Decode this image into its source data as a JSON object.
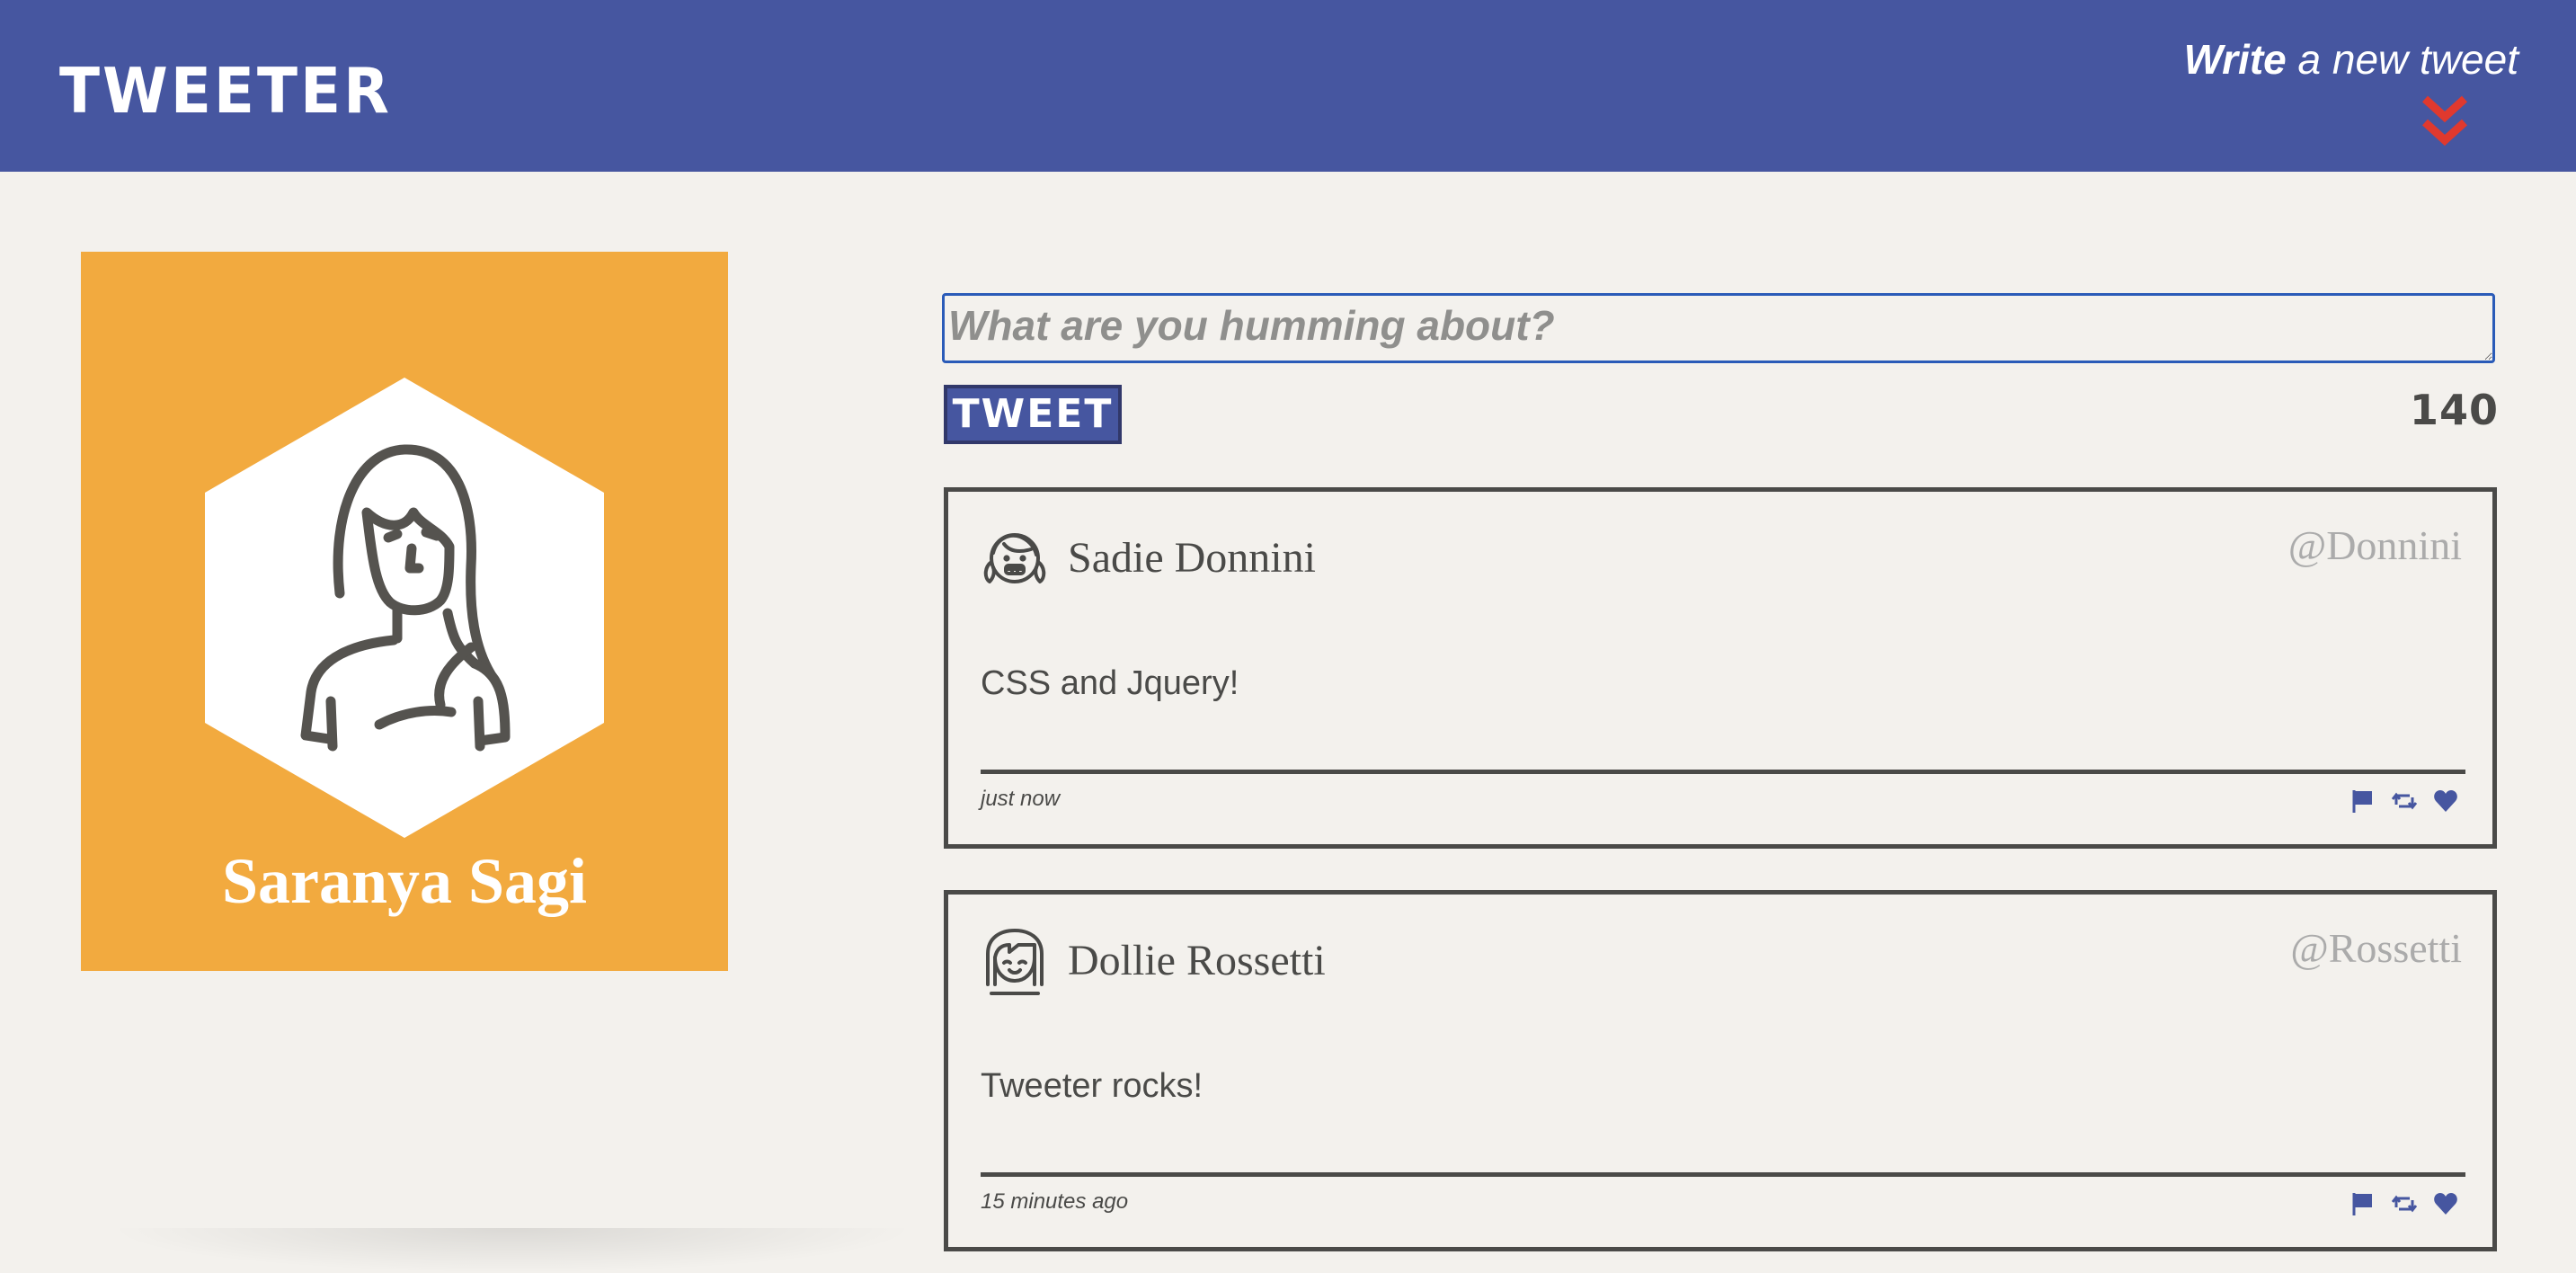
{
  "nav": {
    "brand": "TWEETER",
    "compose_bold": "Write",
    "compose_rest": " a new tweet",
    "chevron_icon": "double-chevron-down-icon",
    "chevron_color": "#e0392e"
  },
  "profile": {
    "name": "Saranya Sagi",
    "avatar_icon": "girl-avatar-icon",
    "background_color": "#f2aa3f"
  },
  "composer": {
    "placeholder": "What are you humming about?",
    "button_label": "TWEET",
    "counter": "140"
  },
  "tweets": [
    {
      "name": "Sadie Donnini",
      "handle": "@Donnini",
      "body": "CSS and Jquery!",
      "time": "just now",
      "avatar_icon": "smiling-girl-avatar-icon"
    },
    {
      "name": "Dollie Rossetti",
      "handle": "@Rossetti",
      "body": "Tweeter rocks!",
      "time": "15 minutes ago",
      "avatar_icon": "bangs-girl-avatar-icon"
    }
  ],
  "colors": {
    "nav": "#4656a0",
    "page": "#f3f1ed",
    "ink": "#4a4a48",
    "handle": "#ababab",
    "action_icons": "#4656a0"
  }
}
